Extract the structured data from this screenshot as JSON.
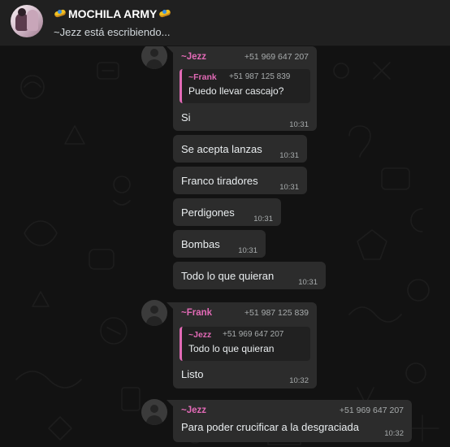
{
  "header": {
    "group_name": "MOCHILA ARMY",
    "status": "~Jezz está escribiendo..."
  },
  "messages": [
    {
      "sender": "~Jezz",
      "phone": "+51 969 647 207",
      "quote": {
        "sender": "~Frank",
        "phone": "+51 987 125 839",
        "text": "Puedo llevar cascajo?"
      },
      "text": "Si",
      "time": "10:31"
    },
    {
      "text": "Se acepta lanzas",
      "time": "10:31"
    },
    {
      "text": "Franco tiradores",
      "time": "10:31"
    },
    {
      "text": "Perdigones",
      "time": "10:31"
    },
    {
      "text": "Bombas",
      "time": "10:31"
    },
    {
      "text": "Todo lo que quieran",
      "time": "10:31"
    },
    {
      "sender": "~Frank",
      "phone": "+51 987 125 839",
      "quote": {
        "sender": "~Jezz",
        "phone": "+51 969 647 207",
        "text": "Todo lo que quieran"
      },
      "text": "Listo",
      "time": "10:32"
    },
    {
      "sender": "~Jezz",
      "phone": "+51 969 647 207",
      "text": "Para poder crucificar a la desgraciada",
      "time": "10:32"
    }
  ]
}
